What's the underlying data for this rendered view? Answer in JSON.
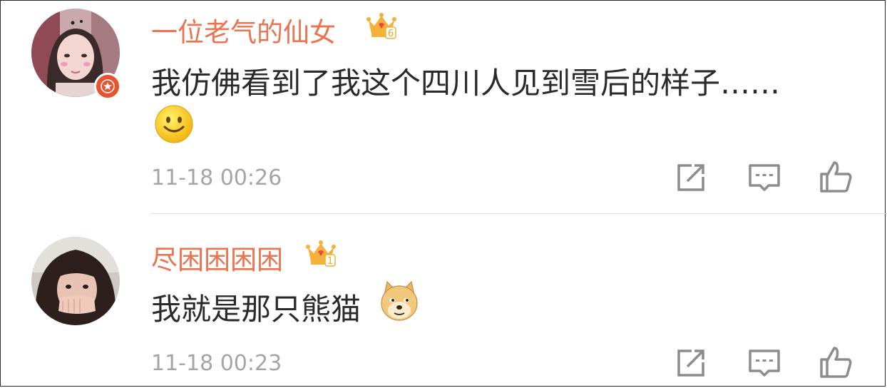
{
  "comments": [
    {
      "username": "一位老气的仙女",
      "crown_level": "6",
      "text": "我仿佛看到了我这个四川人见到雪后的样子……",
      "emoji": "smile-emoji",
      "timestamp": "11-18 00:26",
      "verified_badge": true
    },
    {
      "username": "尽困困困困",
      "crown_level": "1",
      "text": "我就是那只熊猫",
      "emoji": "doge-emoji",
      "timestamp": "11-18 00:23",
      "verified_badge": false
    }
  ],
  "actions": [
    "share-icon",
    "comment-icon",
    "like-icon"
  ],
  "colors": {
    "username": "#eb7350",
    "text": "#2a2a2a",
    "timestamp": "#a5a5a5",
    "icon": "#8c8c8c",
    "badge": "#e8522d",
    "crown": "#f5b13a"
  }
}
